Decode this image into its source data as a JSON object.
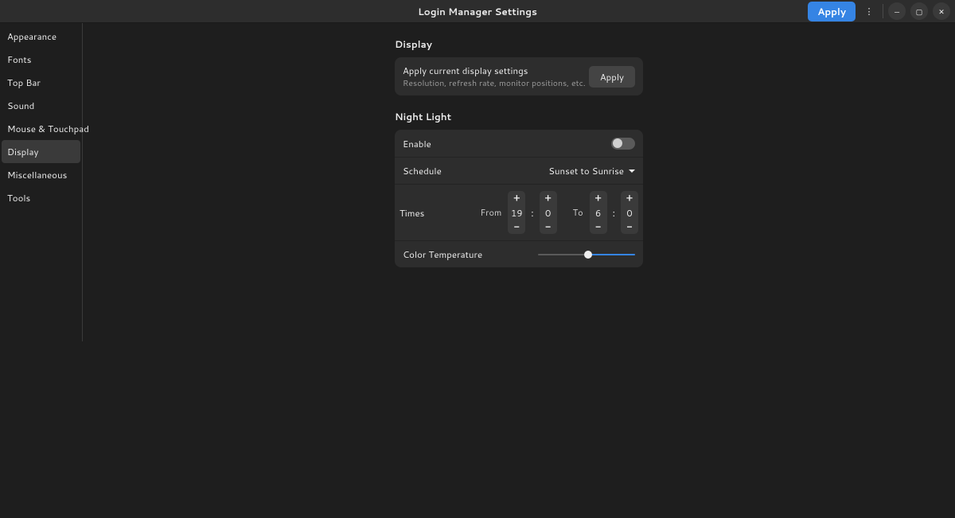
{
  "header": {
    "title": "Login Manager Settings",
    "apply_label": "Apply"
  },
  "sidebar": {
    "items": [
      {
        "label": "Appearance"
      },
      {
        "label": "Fonts"
      },
      {
        "label": "Top Bar"
      },
      {
        "label": "Sound"
      },
      {
        "label": "Mouse & Touchpad"
      },
      {
        "label": "Display"
      },
      {
        "label": "Miscellaneous"
      },
      {
        "label": "Tools"
      }
    ],
    "active_index": 5
  },
  "sections": {
    "display": {
      "title": "Display",
      "apply_settings": {
        "title": "Apply current display settings",
        "subtitle": "Resolution, refresh rate, monitor positions, etc.",
        "button_label": "Apply"
      }
    },
    "night_light": {
      "title": "Night Light",
      "enable": {
        "label": "Enable",
        "value": false
      },
      "schedule": {
        "label": "Schedule",
        "value": "Sunset to Sunrise"
      },
      "times": {
        "label": "Times",
        "from_label": "From",
        "to_label": "To",
        "from_hour": "19",
        "from_min": "0",
        "to_hour": "6",
        "to_min": "0"
      },
      "color_temperature": {
        "label": "Color Temperature",
        "percent": 52
      }
    }
  },
  "glyphs": {
    "plus": "+",
    "minus": "−",
    "more": "⋮",
    "minimize": "—",
    "maximize": "▢",
    "close": "✕"
  }
}
